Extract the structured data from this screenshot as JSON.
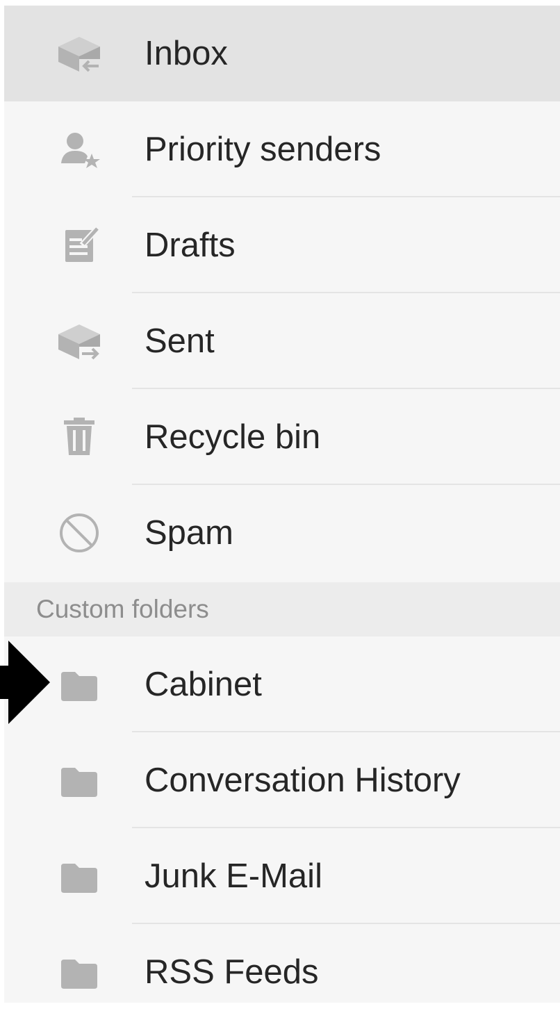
{
  "folders": {
    "items": [
      {
        "label": "Inbox",
        "icon": "inbox-icon",
        "selected": true
      },
      {
        "label": "Priority senders",
        "icon": "priority-senders-icon",
        "selected": false
      },
      {
        "label": "Drafts",
        "icon": "drafts-icon",
        "selected": false
      },
      {
        "label": "Sent",
        "icon": "sent-icon",
        "selected": false
      },
      {
        "label": "Recycle bin",
        "icon": "trash-icon",
        "selected": false
      },
      {
        "label": "Spam",
        "icon": "spam-icon",
        "selected": false
      }
    ]
  },
  "custom_folders": {
    "header": "Custom folders",
    "items": [
      {
        "label": "Cabinet",
        "icon": "folder-icon"
      },
      {
        "label": "Conversation History",
        "icon": "folder-icon"
      },
      {
        "label": "Junk E-Mail",
        "icon": "folder-icon"
      },
      {
        "label": "RSS Feeds",
        "icon": "folder-icon"
      }
    ]
  },
  "annotation": {
    "pointer_target": "Cabinet",
    "icon": "arrow-right-icon"
  },
  "colors": {
    "panel_bg": "#f6f6f6",
    "selected_bg": "#e3e3e3",
    "section_header_bg": "#ececec",
    "text": "#262626",
    "muted_text": "#8d8d8d",
    "icon": "#b3b3b3",
    "divider": "#e4e4e4",
    "annotation_arrow": "#000000"
  }
}
